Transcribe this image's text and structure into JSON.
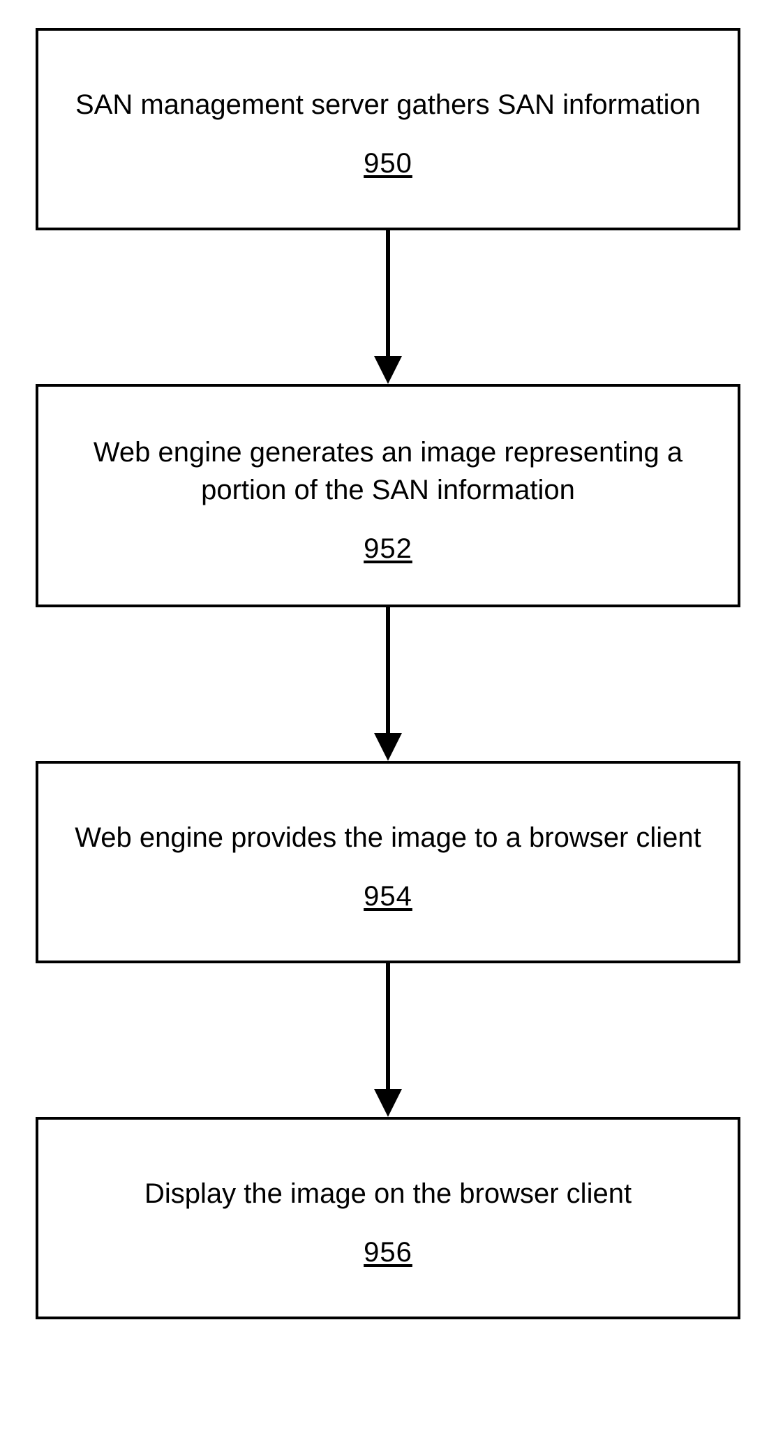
{
  "chart_data": {
    "type": "flowchart",
    "direction": "top-to-bottom",
    "nodes": [
      {
        "id": "950",
        "label": "SAN management server gathers SAN information"
      },
      {
        "id": "952",
        "label": "Web engine generates an image representing a portion of the SAN information"
      },
      {
        "id": "954",
        "label": "Web engine provides the image to a browser client"
      },
      {
        "id": "956",
        "label": "Display the image on the browser client"
      }
    ],
    "edges": [
      {
        "from": "950",
        "to": "952"
      },
      {
        "from": "952",
        "to": "954"
      },
      {
        "from": "954",
        "to": "956"
      }
    ]
  }
}
